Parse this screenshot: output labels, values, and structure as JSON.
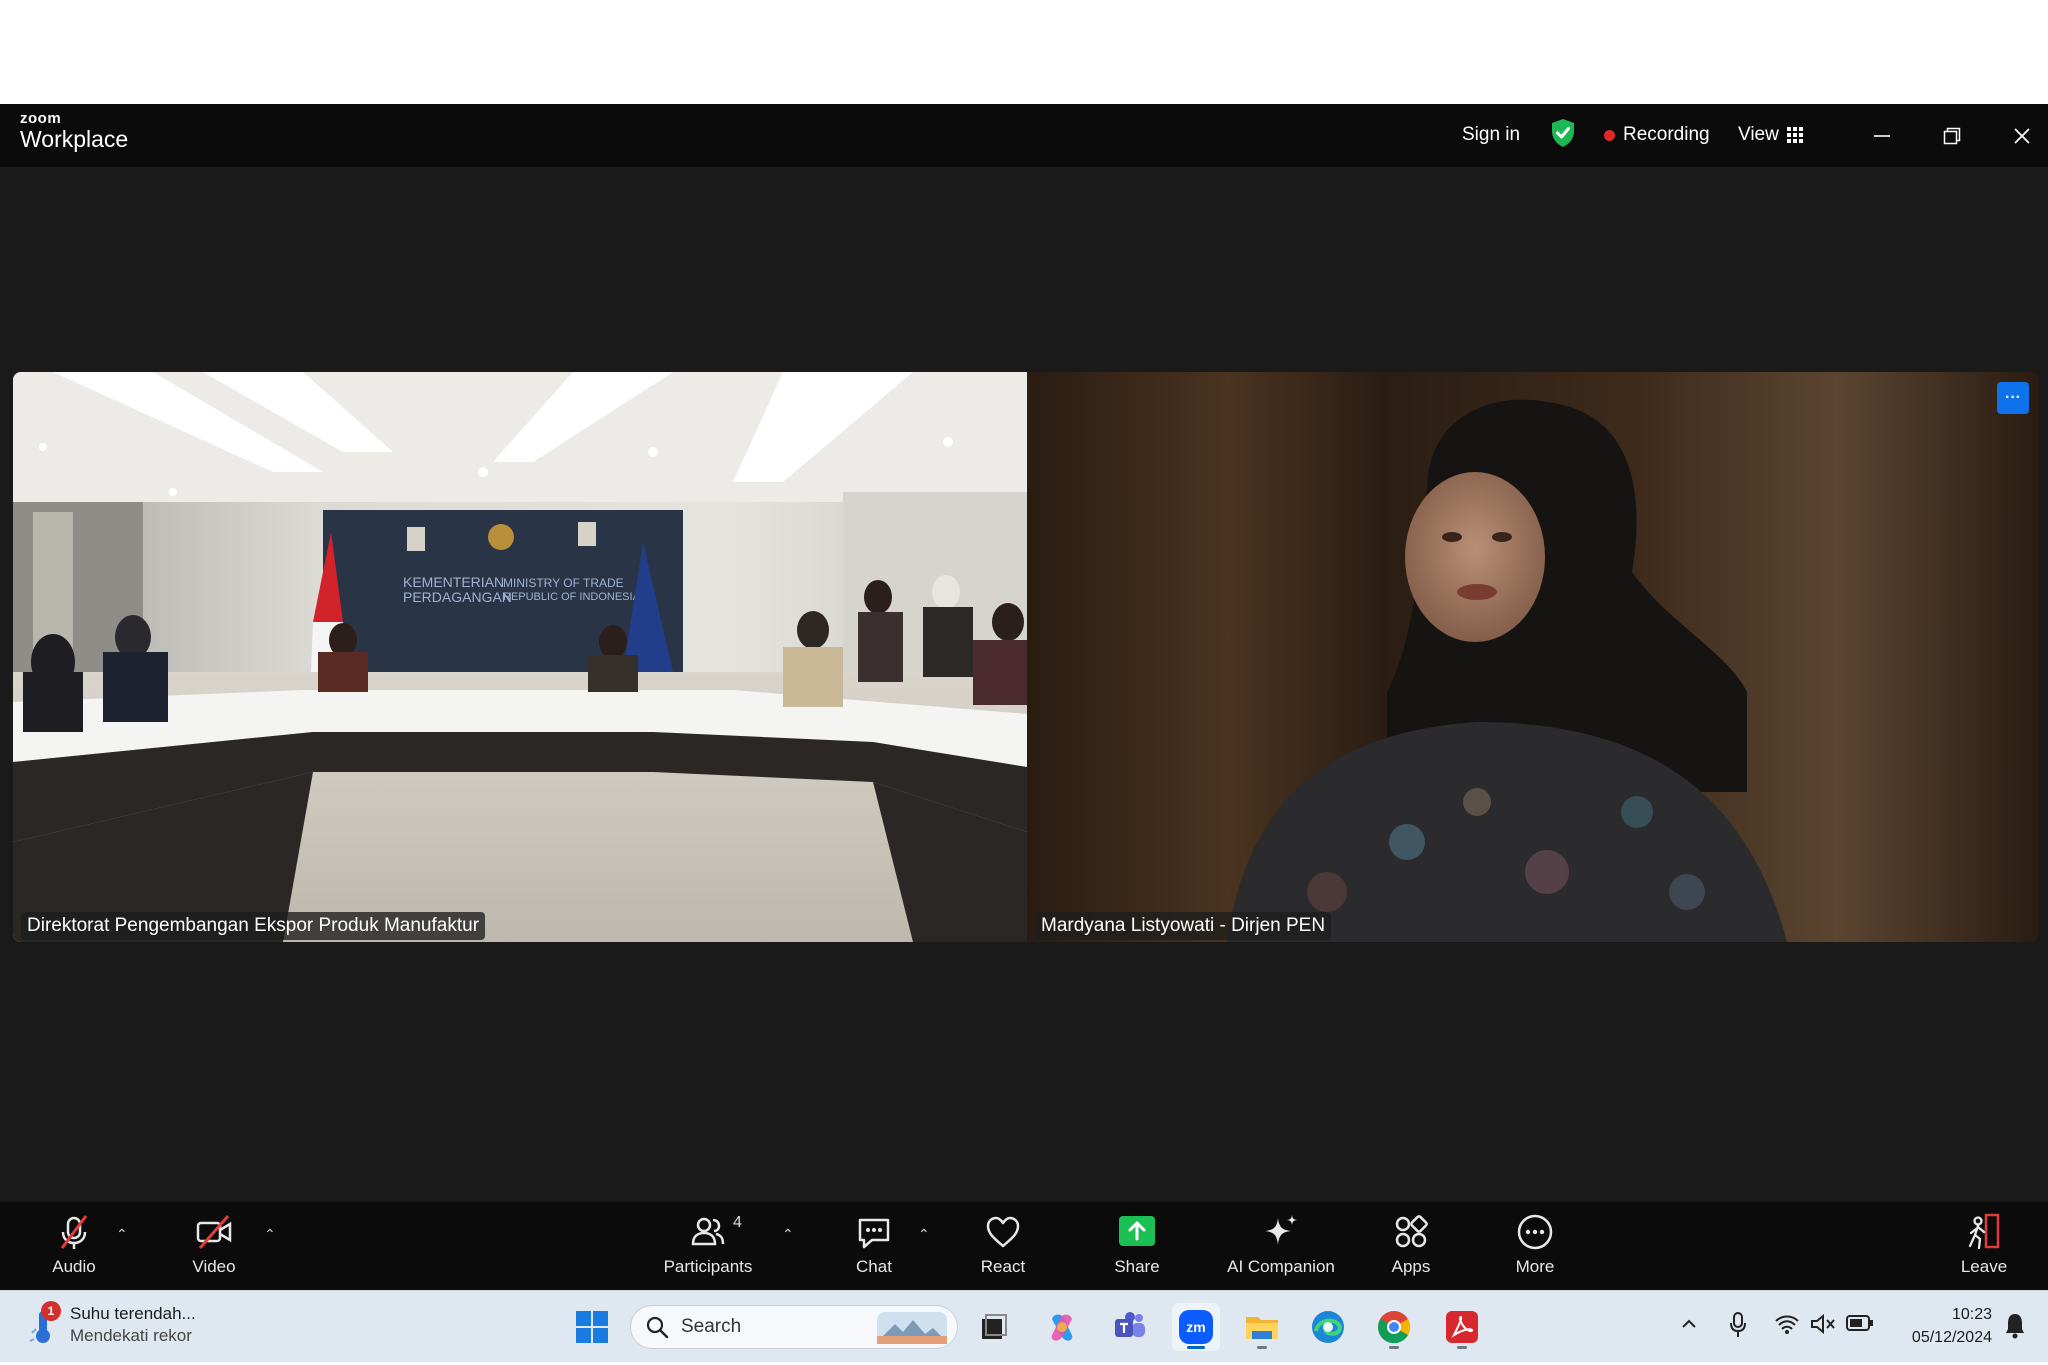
{
  "titlebar": {
    "brand_top": "zoom",
    "brand_bottom": "Workplace",
    "sign_in": "Sign in",
    "recording": "Recording",
    "view": "View"
  },
  "stage": {
    "tile_1_name": "Direktorat Pengembangan Ekspor Produk Manufaktur",
    "tile_2_name": "Mardyana Listyowati - Dirjen PEN",
    "tile_menu": "···",
    "banner_text": [
      "KEMENTERIAN",
      "PERDAGANGAN",
      "MINISTRY OF TRADE",
      "REPUBLIC OF INDONESIA"
    ]
  },
  "toolbar": {
    "audio": "Audio",
    "video": "Video",
    "participants": "Participants",
    "participants_count": "4",
    "chat": "Chat",
    "react": "React",
    "share": "Share",
    "ai_companion": "AI Companion",
    "apps": "Apps",
    "more": "More",
    "leave": "Leave"
  },
  "taskbar": {
    "weather_title": "Suhu terendah...",
    "weather_sub": "Mendekati rekor",
    "weather_badge": "1",
    "search_placeholder": "Search",
    "time": "10:23",
    "date": "05/12/2024"
  },
  "colors": {
    "share_green": "#1bbf53",
    "recording_red": "#e02828",
    "zoom_blue": "#0e72ed",
    "mute_red": "#e23b3b"
  }
}
